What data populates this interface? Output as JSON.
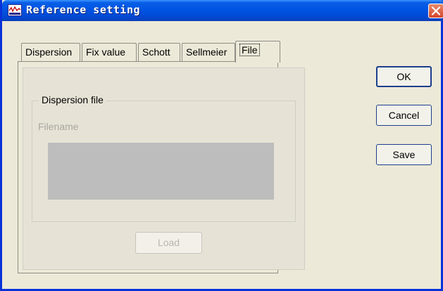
{
  "window": {
    "title": "Reference setting",
    "colors": {
      "titlebar": "#0054e3",
      "face": "#ece9d8",
      "close": "#d5452a"
    }
  },
  "tabs": [
    {
      "label": "Dispersion",
      "active": false
    },
    {
      "label": "Fix value",
      "active": false
    },
    {
      "label": "Schott",
      "active": false
    },
    {
      "label": "Sellmeier",
      "active": false
    },
    {
      "label": "File",
      "active": true
    }
  ],
  "panel": {
    "group_title": "Dispersion file",
    "filename_label": "Filename",
    "load_label": "Load"
  },
  "buttons": {
    "ok_label": "OK",
    "cancel_label": "Cancel",
    "save_label": "Save"
  },
  "icons": {
    "app": "waveform-app-icon",
    "close": "close-icon"
  }
}
